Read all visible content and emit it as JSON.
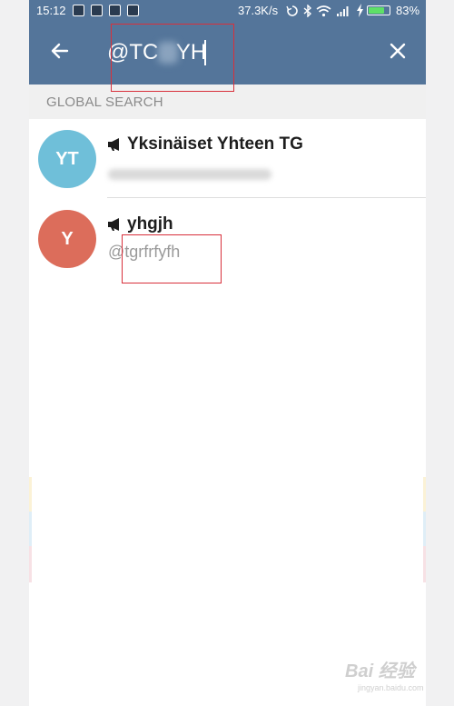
{
  "status_bar": {
    "time": "15:12",
    "network_speed": "37.3K/s",
    "battery_percent": "83%",
    "battery_level": 0.83,
    "icons": [
      "sync-icon",
      "bluetooth-icon",
      "wifi-icon",
      "signal-icon",
      "charging-icon"
    ]
  },
  "search": {
    "value": "@TC   YH",
    "back_icon": "arrow-left-icon",
    "close_icon": "close-icon"
  },
  "section_header": "GLOBAL SEARCH",
  "results": [
    {
      "avatar_initials": "YT",
      "avatar_color": "#6fbfd9",
      "name": "Yksinäiset Yhteen TG",
      "type_icon": "megaphone-icon"
    },
    {
      "avatar_initials": "Y",
      "avatar_color": "#dc6d5b",
      "name": "yhgjh",
      "username": "@tgrfrfyfh",
      "type_icon": "megaphone-icon"
    }
  ],
  "colors": {
    "header": "#54759a",
    "highlight_box": "#d8303b"
  },
  "watermark": {
    "brand": "Bai 经验",
    "url": "jingyan.baidu.com"
  }
}
